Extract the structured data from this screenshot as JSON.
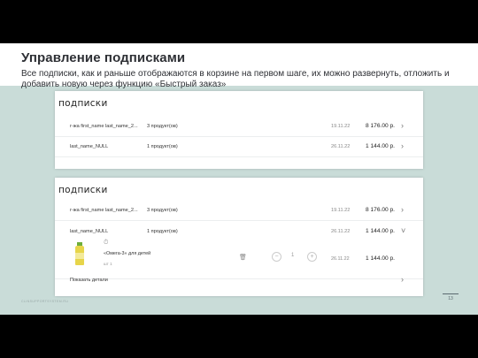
{
  "slide": {
    "title": "Управление подписками",
    "subtitle": "Все подписки, как и раньше отображаются в корзине на первом шаге, их можно развернуть, отложить и добавить новую через функцию «Быстрый заказ»",
    "footer_text": "CLINSUPPORTSYSTEM.RU",
    "page_number": "13"
  },
  "panel1": {
    "title": "подписки",
    "rows": [
      {
        "name": "г-жа first_name last_name_2...",
        "count": "3 продукт(ов)",
        "date": "19.11.22",
        "price": "8 176.00 р.",
        "arrow": "›"
      },
      {
        "name": "last_name_NULL",
        "count": "1 продукт(ов)",
        "date": "26.11.22",
        "price": "1 144.00 р.",
        "arrow": "›"
      }
    ]
  },
  "panel2": {
    "title": "подписки",
    "rows": [
      {
        "name": "г-жа first_name last_name_2...",
        "count": "3 продукт(ов)",
        "date": "19.11.22",
        "price": "8 176.00 р.",
        "arrow": "›"
      },
      {
        "name": "last_name_NULL",
        "count": "1 продукт(ов)",
        "date": "26.11.22",
        "price": "1 144.00 р.",
        "arrow": "˅"
      }
    ],
    "product": {
      "name": "«Омега-3» для детей",
      "qty_label": "шт 1",
      "quantity": "1",
      "date": "26.11.22",
      "price": "1 144.00 р."
    },
    "details_link": "Показать детали",
    "details_arrow": "›"
  },
  "colors": {
    "slide_bg": "#c9dcd8",
    "product_yellow": "#e7d54a"
  }
}
